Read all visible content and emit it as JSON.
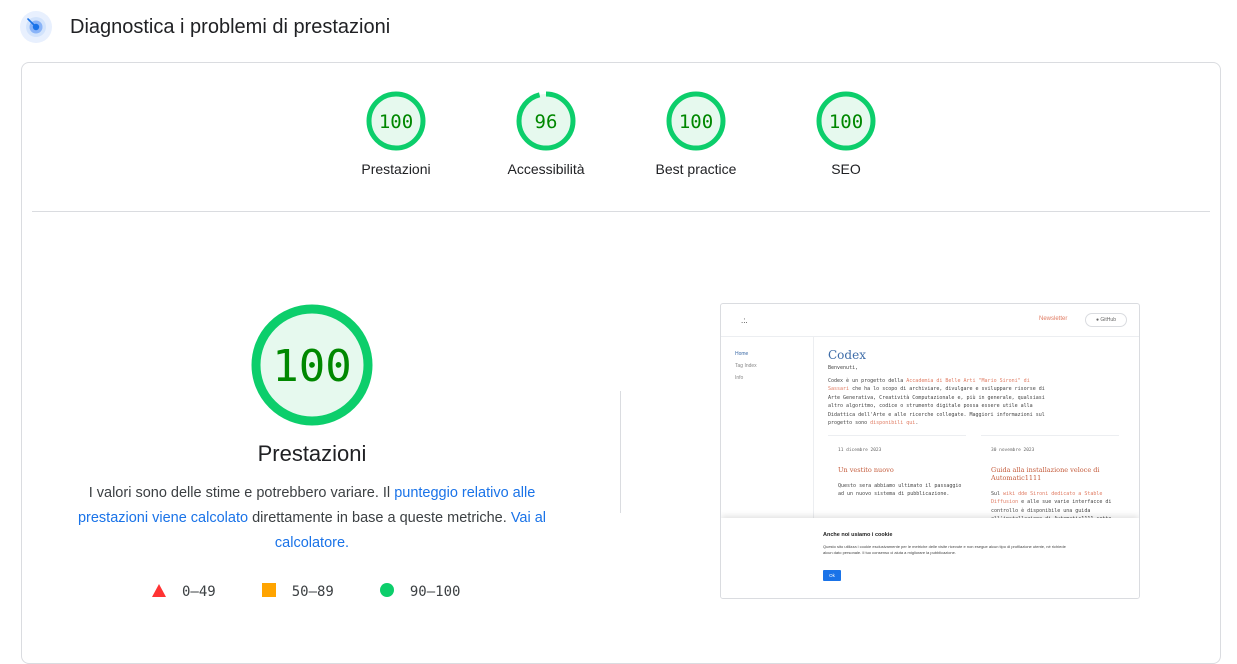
{
  "header": {
    "title": "Diagnostica i problemi di prestazioni"
  },
  "colors": {
    "pass": "#0cce6b",
    "pass_text": "#008800",
    "pass_bg": "#e6f9ee",
    "average": "#ffa400",
    "fail": "#ff3333",
    "link": "#1a73e8"
  },
  "gauges": [
    {
      "score": "100",
      "label": "Prestazioni",
      "value": 1.0
    },
    {
      "score": "96",
      "label": "Accessibilità",
      "value": 0.96
    },
    {
      "score": "100",
      "label": "Best practice",
      "value": 1.0
    },
    {
      "score": "100",
      "label": "SEO",
      "value": 1.0
    }
  ],
  "main": {
    "score": "100",
    "score_value": 1.0,
    "title": "Prestazioni",
    "desc_1": "I valori sono delle stime e potrebbero variare. Il ",
    "link_1": "punteggio relativo alle prestazioni viene calcolato",
    "desc_2": " direttamente in base a queste metriche. ",
    "link_2": "Vai al calcolatore.",
    "legend": [
      {
        "icon": "triangle-icon",
        "range": "0–49"
      },
      {
        "icon": "square-icon",
        "range": "50–89"
      },
      {
        "icon": "circle-icon",
        "range": "90–100"
      }
    ]
  },
  "screenshot": {
    "logo": ".:.",
    "newsletter": "Newsletter",
    "github": "GitHub",
    "nav": [
      "Home",
      "Tag Index",
      "Info"
    ],
    "title": "Codex",
    "welcome": "Benvenuti,",
    "para_1": "Codex è un progetto della ",
    "para_link_1": "Accademia di Belle Arti \"Mario Sironi\" di Sassari",
    "para_2": " che ha lo scopo di archiviare, divulgare e sviluppare risorse di Arte Generativa, Creatività Computazionale e, più in generale, qualsiasi altro algoritmo, codice o strumento digitale possa essere utile alla Didattica dell'Arte e alle ricerche collegate. Maggiori informazioni sul progetto sono ",
    "para_link_2": "disponibili qui",
    "para_3": ".",
    "cards": [
      {
        "date": "11 dicembre 2023",
        "title": "Un vestito nuovo",
        "body": "Questo sera abbiamo ultimato il passaggio ad un nuovo sistema di pubblicazione."
      },
      {
        "date": "30 novembre 2023",
        "title": "Guida alla installazione veloce di Automatic1111",
        "body_1": "Sul ",
        "body_link_1": "wiki dde Sironi dedicato a Stable Diffusion",
        "body_2": " e alle sue varie interfacce di controllo è disponibile una guida all'installazione di Automatic1111 sotto"
      }
    ],
    "cookie": {
      "title": "Anche noi usiamo i cookie",
      "body": "Questo sito utilizza i cookie esclusivamente per le metriche delle visite ricevute e non esegue alcun tipo di profilazione utente, né richiede alcun dato personale. Il tuo consenso ci aiuta a migliorare la pubblicazione.",
      "ok": "Ok"
    }
  }
}
